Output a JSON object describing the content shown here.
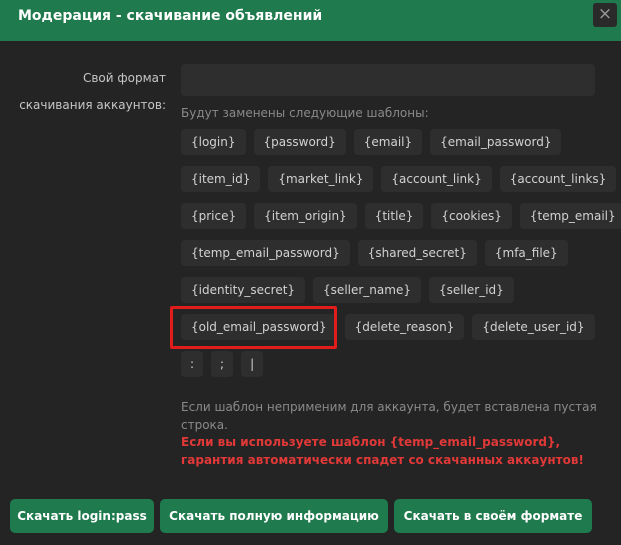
{
  "dialog": {
    "title": "Модерация - скачивание объявлений",
    "close_glyph": "×"
  },
  "form": {
    "label_line1": "Свой формат",
    "label_line2": "скачивания аккаунтов:",
    "input_value": "",
    "templates_hint": "Будут заменены следующие шаблоны:",
    "template_rows": [
      [
        "{login}",
        "{password}",
        "{email}",
        "{email_password}"
      ],
      [
        "{item_id}",
        "{market_link}",
        "{account_link}",
        "{account_links}"
      ],
      [
        "{price}",
        "{item_origin}",
        "{title}",
        "{cookies}",
        "{temp_email}"
      ],
      [
        "{temp_email_password}",
        "{shared_secret}",
        "{mfa_file}"
      ],
      [
        "{identity_secret}",
        "{seller_name}",
        "{seller_id}"
      ],
      [
        "{old_email_password}",
        "{delete_reason}",
        "{delete_user_id}"
      ],
      [
        ":",
        ";",
        "|"
      ]
    ],
    "note_gray": "Если шаблон неприменим для аккаунта, будет вставлена пустая строка.",
    "note_red": "Если вы используете шаблон {temp_email_password}, гарантия автоматически спадет со скачанных аккаунтов!"
  },
  "footer": {
    "btn_loginpass": "Скачать login:pass",
    "btn_full": "Скачать полную информацию",
    "btn_custom": "Скачать в своём формате"
  },
  "colors": {
    "background": "#242424",
    "header": "#1f7a4d",
    "chip": "#2e2e2e",
    "highlight": "#e21b1b",
    "warning": "#e13838"
  }
}
